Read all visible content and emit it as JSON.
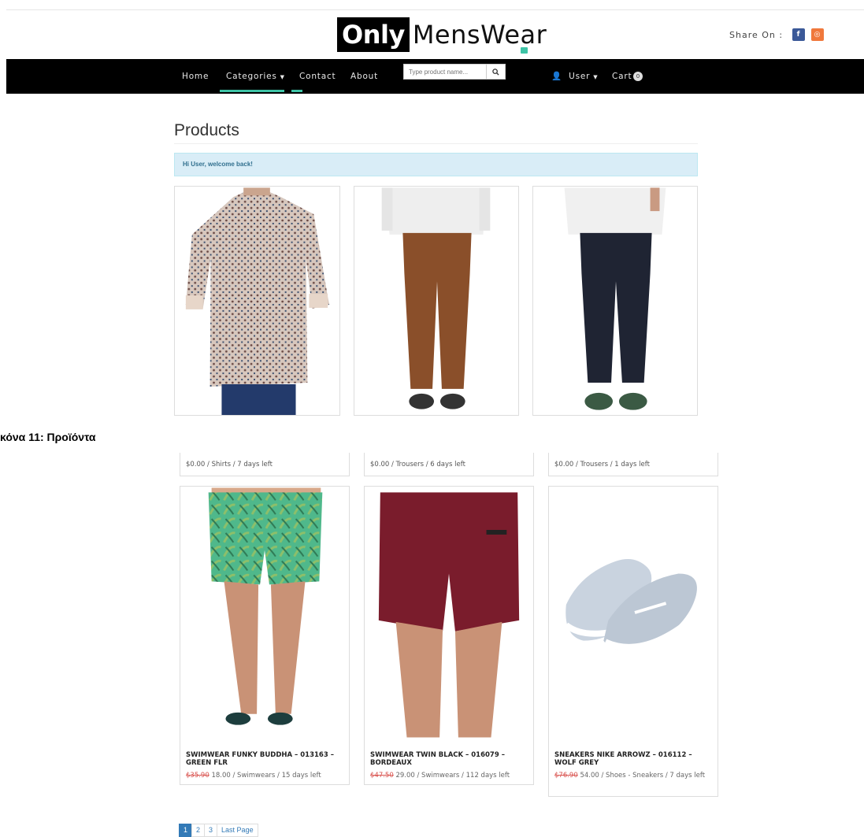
{
  "header": {
    "logo_only": "Only",
    "logo_menswear": "MensWear",
    "share_label": "Share On :",
    "share_facebook_glyph": "f",
    "share_instagram_glyph": "◎"
  },
  "nav": {
    "home": "Home",
    "categories": "Categories",
    "contact": "Contact",
    "about": "About",
    "search_placeholder": "Type product name...",
    "search_icon": "search-icon",
    "user": "User",
    "cart": "Cart",
    "cart_count": "0"
  },
  "main": {
    "title": "Products",
    "alert": "Hi User, welcome back!"
  },
  "caption": "κόνα 11: Προϊόντα",
  "top_row_meta": [
    "$0.00 / Shirts / 7 days left",
    "$0.00 / Trousers / 6 days left",
    "$0.00 / Trousers / 1 days left"
  ],
  "products": [
    {
      "name": "SWIMWEAR FUNKY BUDDHA – 013163 – GREEN FLR",
      "old_price": "$35.90",
      "details": "18.00 / Swimwears / 15 days left"
    },
    {
      "name": "SWIMWEAR TWIN BLACK – 016079 – BORDEAUX",
      "old_price": "$47.50",
      "details": "29.00 / Swimwears / 112 days left"
    },
    {
      "name": "SNEAKERS NIKE ARROWZ – 016112 – WOLF GREY",
      "old_price": "$76.90",
      "details": "54.00 / Shoes - Sneakers / 7 days left"
    }
  ],
  "pagination": [
    "1",
    "2",
    "3",
    "Last Page"
  ],
  "colors": {
    "accent": "#3ec3a6",
    "navbar": "#000000",
    "alert_bg": "#d9edf7",
    "link": "#337ab7",
    "old_price": "#d9534f"
  }
}
